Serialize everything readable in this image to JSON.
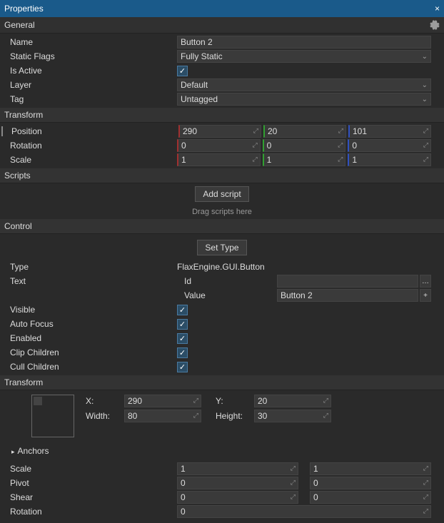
{
  "window": {
    "title": "Properties"
  },
  "general": {
    "header": "General",
    "name_label": "Name",
    "name": "Button 2",
    "staticflags_label": "Static Flags",
    "staticflags": "Fully Static",
    "isactive_label": "Is Active",
    "isactive": true,
    "layer_label": "Layer",
    "layer": "Default",
    "tag_label": "Tag",
    "tag": "Untagged"
  },
  "transform": {
    "header": "Transform",
    "position_label": "Position",
    "position": {
      "x": "290",
      "y": "20",
      "z": "101"
    },
    "rotation_label": "Rotation",
    "rotation": {
      "x": "0",
      "y": "0",
      "z": "0"
    },
    "scale_label": "Scale",
    "scale": {
      "x": "1",
      "y": "1",
      "z": "1"
    }
  },
  "scripts": {
    "header": "Scripts",
    "add_btn": "Add script",
    "hint": "Drag scripts here"
  },
  "control": {
    "header": "Control",
    "settype_btn": "Set Type",
    "type_label": "Type",
    "type": "FlaxEngine.GUI.Button",
    "text_label": "Text",
    "id_label": "Id",
    "id": "",
    "value_label": "Value",
    "value": "Button 2",
    "visible_label": "Visible",
    "visible": true,
    "autofocus_label": "Auto Focus",
    "autofocus": true,
    "enabled_label": "Enabled",
    "enabled": true,
    "clipchildren_label": "Clip Children",
    "clipchildren": true,
    "cullchildren_label": "Cull Children",
    "cullchildren": true
  },
  "ctransform": {
    "header": "Transform",
    "x_label": "X:",
    "x": "290",
    "y_label": "Y:",
    "y": "20",
    "w_label": "Width:",
    "w": "80",
    "h_label": "Height:",
    "h": "30",
    "anchors_label": "Anchors",
    "scale_label": "Scale",
    "scale": {
      "x": "1",
      "y": "1"
    },
    "pivot_label": "Pivot",
    "pivot": {
      "x": "0",
      "y": "0"
    },
    "shear_label": "Shear",
    "shear": {
      "x": "0",
      "y": "0"
    },
    "rotation_label": "Rotation",
    "rotation": "0"
  }
}
